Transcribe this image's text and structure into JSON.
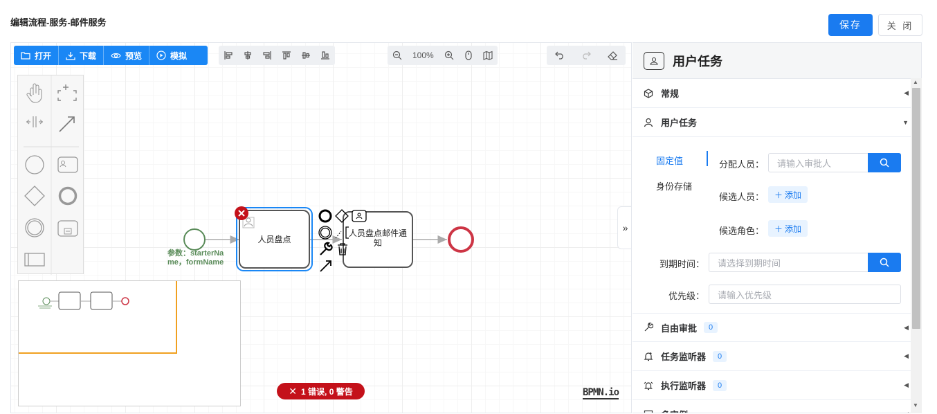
{
  "header": {
    "title": "编辑流程-服务-邮件服务",
    "save_label": "保存",
    "close_label": "关 闭"
  },
  "toolbar": {
    "file": [
      {
        "label": "打开",
        "icon": "folder-icon"
      },
      {
        "label": "下载",
        "icon": "download-icon"
      },
      {
        "label": "预览",
        "icon": "eye-icon"
      },
      {
        "label": "模拟",
        "icon": "play-icon"
      }
    ],
    "align": [
      "align-left-icon",
      "align-center-icon",
      "align-right-icon",
      "align-top-icon",
      "align-middle-icon",
      "align-bottom-icon"
    ],
    "zoom_level": "100%",
    "view": [
      "zoom-out-icon",
      "zoom-in-icon",
      "mouse-icon",
      "map-icon"
    ],
    "history": [
      "undo-icon",
      "redo-icon",
      "eraser-icon"
    ]
  },
  "diagram": {
    "start_label": "参数：starterName，formName",
    "task1_label": "人员盘点",
    "task2_label": "人员盘点邮件通知"
  },
  "status": {
    "errors_label": "1 错误, 0 警告"
  },
  "watermark": "BPMN.io",
  "panel": {
    "title": "用户任务",
    "sections": {
      "general": "常规",
      "user_task": "用户任务",
      "free_approval": "自由审批",
      "free_approval_count": "0",
      "task_listener": "任务监听器",
      "task_listener_count": "0",
      "exec_listener": "执行监听器",
      "exec_listener_count": "0",
      "multi_instance": "多实例"
    },
    "tabs": {
      "fixed": "固定值",
      "identity": "身份存储"
    },
    "fields": {
      "assignee_label": "分配人员：",
      "assignee_placeholder": "请输入审批人",
      "candidate_users_label": "候选人员：",
      "candidate_roles_label": "候选角色：",
      "add_label": "添加",
      "due_label": "到期时间：",
      "due_placeholder": "请选择到期时间",
      "priority_label": "优先级：",
      "priority_placeholder": "请输入优先级"
    }
  },
  "colors": {
    "primary": "#1a7bf0",
    "error": "#c4111a",
    "end_event": "#cd3545",
    "start_event": "#5b8c5a",
    "selection": "#1a87f5"
  }
}
